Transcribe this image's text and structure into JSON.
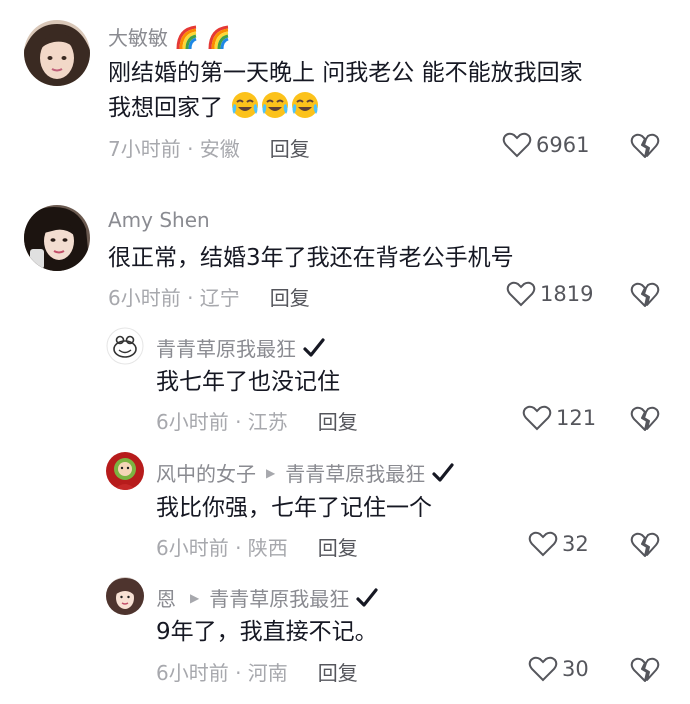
{
  "comments": [
    {
      "username": "大敏敏",
      "name_emojis": [
        "rainbow-icon",
        "rainbow-icon"
      ],
      "text_line1": "刚结婚的第一天晚上 问我老公 能不能放我回家",
      "text_line2": "我想回家了",
      "text_emojis": [
        "crying-laugh-emoji-icon",
        "crying-laugh-emoji-icon",
        "crying-laugh-emoji-icon"
      ],
      "time_location": "7小时前 · 安徽",
      "reply_label": "回复",
      "likes": "6961"
    },
    {
      "username": "Amy Shen",
      "text_line1": "很正常，结婚3年了我还在背老公手机号",
      "time_location": "6小时前 · 辽宁",
      "reply_label": "回复",
      "likes": "1819"
    },
    {
      "username": "青青草原我最狂",
      "text_line1": "我七年了也没记住",
      "time_location": "6小时前 · 江苏",
      "reply_label": "回复",
      "likes": "121"
    },
    {
      "username": "风中的女子",
      "reply_to": "青青草原我最狂",
      "text_line1": "我比你强，七年了记住一个",
      "time_location": "6小时前 · 陕西",
      "reply_label": "回复",
      "likes": "32"
    },
    {
      "username": "恩",
      "reply_to": "青青草原我最狂",
      "text_line1": "9年了，我直接不记。",
      "time_location": "6小时前 · 河南",
      "reply_label": "回复",
      "likes": "30"
    }
  ],
  "colors": {
    "text": "#161823",
    "username": "#8a8b91",
    "meta": "#a7a8ad",
    "reply": "#55565c"
  }
}
